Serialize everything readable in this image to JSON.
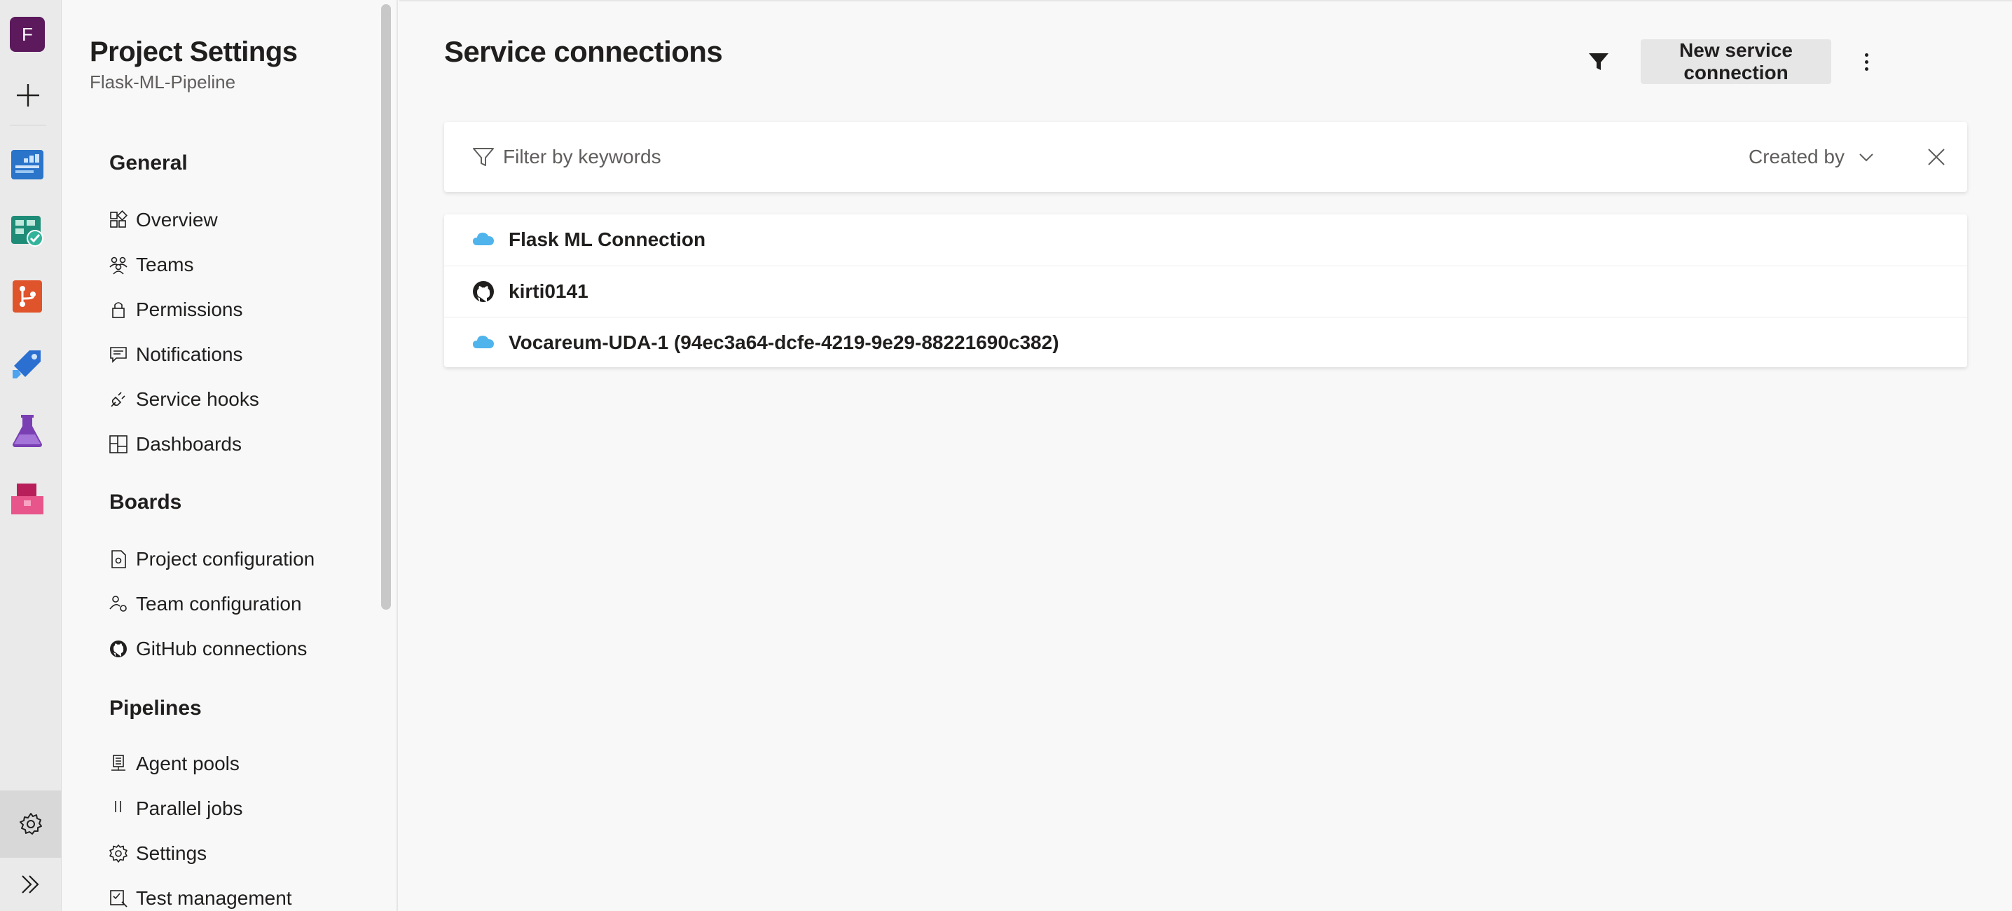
{
  "rail": {
    "org_initial": "F",
    "apps": [
      "overview-app-icon",
      "boards-app-icon",
      "repos-app-icon",
      "pipelines-app-icon",
      "test-plans-app-icon",
      "artifacts-app-icon"
    ],
    "bottom": [
      "settings-gear-icon",
      "expand-chevrons-icon"
    ]
  },
  "nav": {
    "title": "Project Settings",
    "project": "Flask-ML-Pipeline",
    "sections": [
      {
        "label": "General",
        "items": [
          {
            "label": "Overview",
            "icon": "overview-icon"
          },
          {
            "label": "Teams",
            "icon": "teams-icon"
          },
          {
            "label": "Permissions",
            "icon": "lock-icon"
          },
          {
            "label": "Notifications",
            "icon": "chat-icon"
          },
          {
            "label": "Service hooks",
            "icon": "plug-icon"
          },
          {
            "label": "Dashboards",
            "icon": "dashboard-icon"
          }
        ]
      },
      {
        "label": "Boards",
        "items": [
          {
            "label": "Project configuration",
            "icon": "document-gear-icon"
          },
          {
            "label": "Team configuration",
            "icon": "team-gear-icon"
          },
          {
            "label": "GitHub connections",
            "icon": "github-icon"
          }
        ]
      },
      {
        "label": "Pipelines",
        "items": [
          {
            "label": "Agent pools",
            "icon": "agent-icon"
          },
          {
            "label": "Parallel jobs",
            "icon": "parallel-icon"
          },
          {
            "label": "Settings",
            "icon": "gear-icon"
          },
          {
            "label": "Test management",
            "icon": "test-icon"
          }
        ]
      }
    ]
  },
  "main": {
    "heading": "Service connections",
    "new_button": "New service connection",
    "filter": {
      "placeholder": "Filter by keywords",
      "created_by": "Created by"
    },
    "connections": [
      {
        "name": "Flask ML Connection",
        "icon": "azure-cloud-icon"
      },
      {
        "name": "kirti0141",
        "icon": "github-icon"
      },
      {
        "name": "Vocareum-UDA-1 (94ec3a64-dcfe-4219-9e29-88221690c382)",
        "icon": "azure-cloud-icon"
      }
    ]
  },
  "colors": {
    "org_tile": "#5c1a5c",
    "azure_cloud": "#4fb3ec",
    "background": "#f8f8f8"
  }
}
